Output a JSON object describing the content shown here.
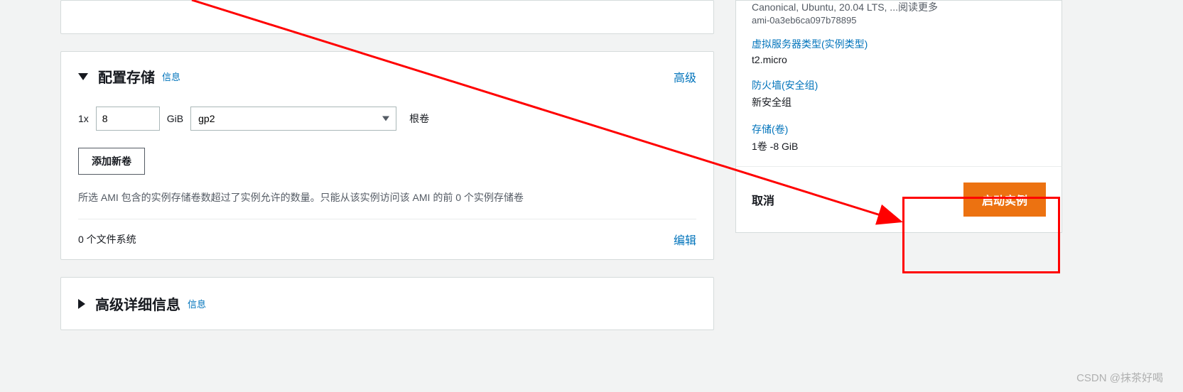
{
  "storage": {
    "title": "配置存储",
    "info_label": "信息",
    "advanced_link": "高级",
    "qty_label": "1x",
    "size_value": "8",
    "unit_label": "GiB",
    "volume_type": "gp2",
    "root_label": "根卷",
    "add_volume_btn": "添加新卷",
    "note": "所选 AMI 包含的实例存储卷数超过了实例允许的数量。只能从该实例访问该 AMI 的前 0 个实例存储卷",
    "fs_count_text": "0 个文件系统",
    "edit_link": "编辑"
  },
  "advanced": {
    "title": "高级详细信息",
    "info_label": "信息"
  },
  "summary": {
    "ami_line": "Canonical, Ubuntu, 20.04 LTS, ...阅读更多",
    "ami_id": "ami-0a3eb6ca097b78895",
    "instance_type_label": "虚拟服务器类型(实例类型)",
    "instance_type_value": "t2.micro",
    "firewall_label": "防火墙(安全组)",
    "firewall_value": "新安全组",
    "storage_label": "存储(卷)",
    "storage_value": "1卷 -8 GiB"
  },
  "footer": {
    "cancel": "取消",
    "launch": "启动实例"
  },
  "watermark": "CSDN @抹茶好喝"
}
